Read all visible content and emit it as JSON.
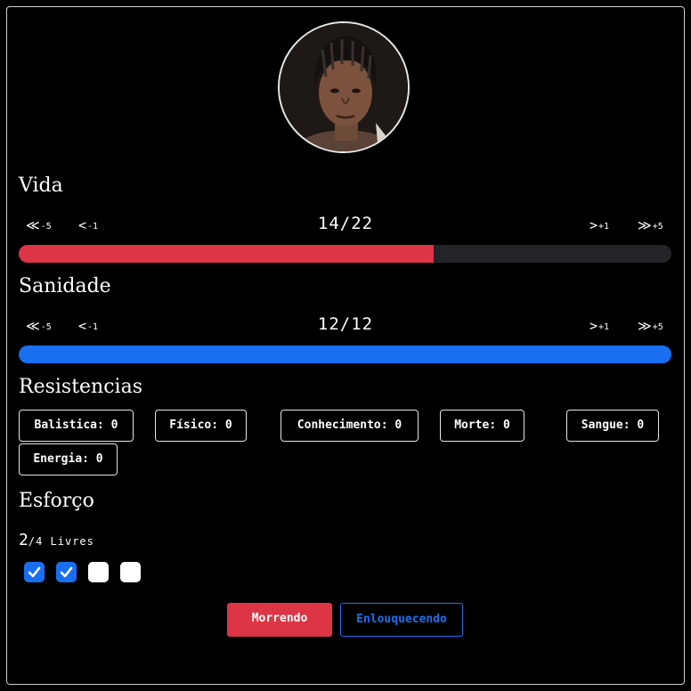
{
  "vida": {
    "title": "Vida",
    "dec5_label": "-5",
    "dec1_label": "-1",
    "inc1_label": "+1",
    "inc5_label": "+5",
    "current": 14,
    "max": 22,
    "display": "14/22",
    "color": "#dc3545"
  },
  "sanidade": {
    "title": "Sanidade",
    "dec5_label": "-5",
    "dec1_label": "-1",
    "inc1_label": "+1",
    "inc5_label": "+5",
    "current": 12,
    "max": 12,
    "display": "12/12",
    "color": "#1a6ff0"
  },
  "resistencias": {
    "title": "Resistencias",
    "items": [
      {
        "label": "Balistica: 0"
      },
      {
        "label": "Físico: 0"
      },
      {
        "label": "Conhecimento: 0"
      },
      {
        "label": "Morte: 0"
      },
      {
        "label": "Sangue: 0"
      },
      {
        "label": "Energia: 0"
      }
    ]
  },
  "esforco": {
    "title": "Esforço",
    "free": "2",
    "total_text": "/4 Livres",
    "checks": [
      true,
      true,
      false,
      false
    ]
  },
  "actions": {
    "morrendo_label": "Morrendo",
    "enlouquecendo_label": "Enlouquecendo",
    "morrendo_color": "#dc3545",
    "enlouquecendo_color": "#1a6ff0"
  },
  "icons": {
    "dec5": "double-chevron-left-icon",
    "dec1": "chevron-left-icon",
    "inc1": "chevron-right-icon",
    "inc5": "double-chevron-right-icon",
    "check": "check-icon"
  }
}
